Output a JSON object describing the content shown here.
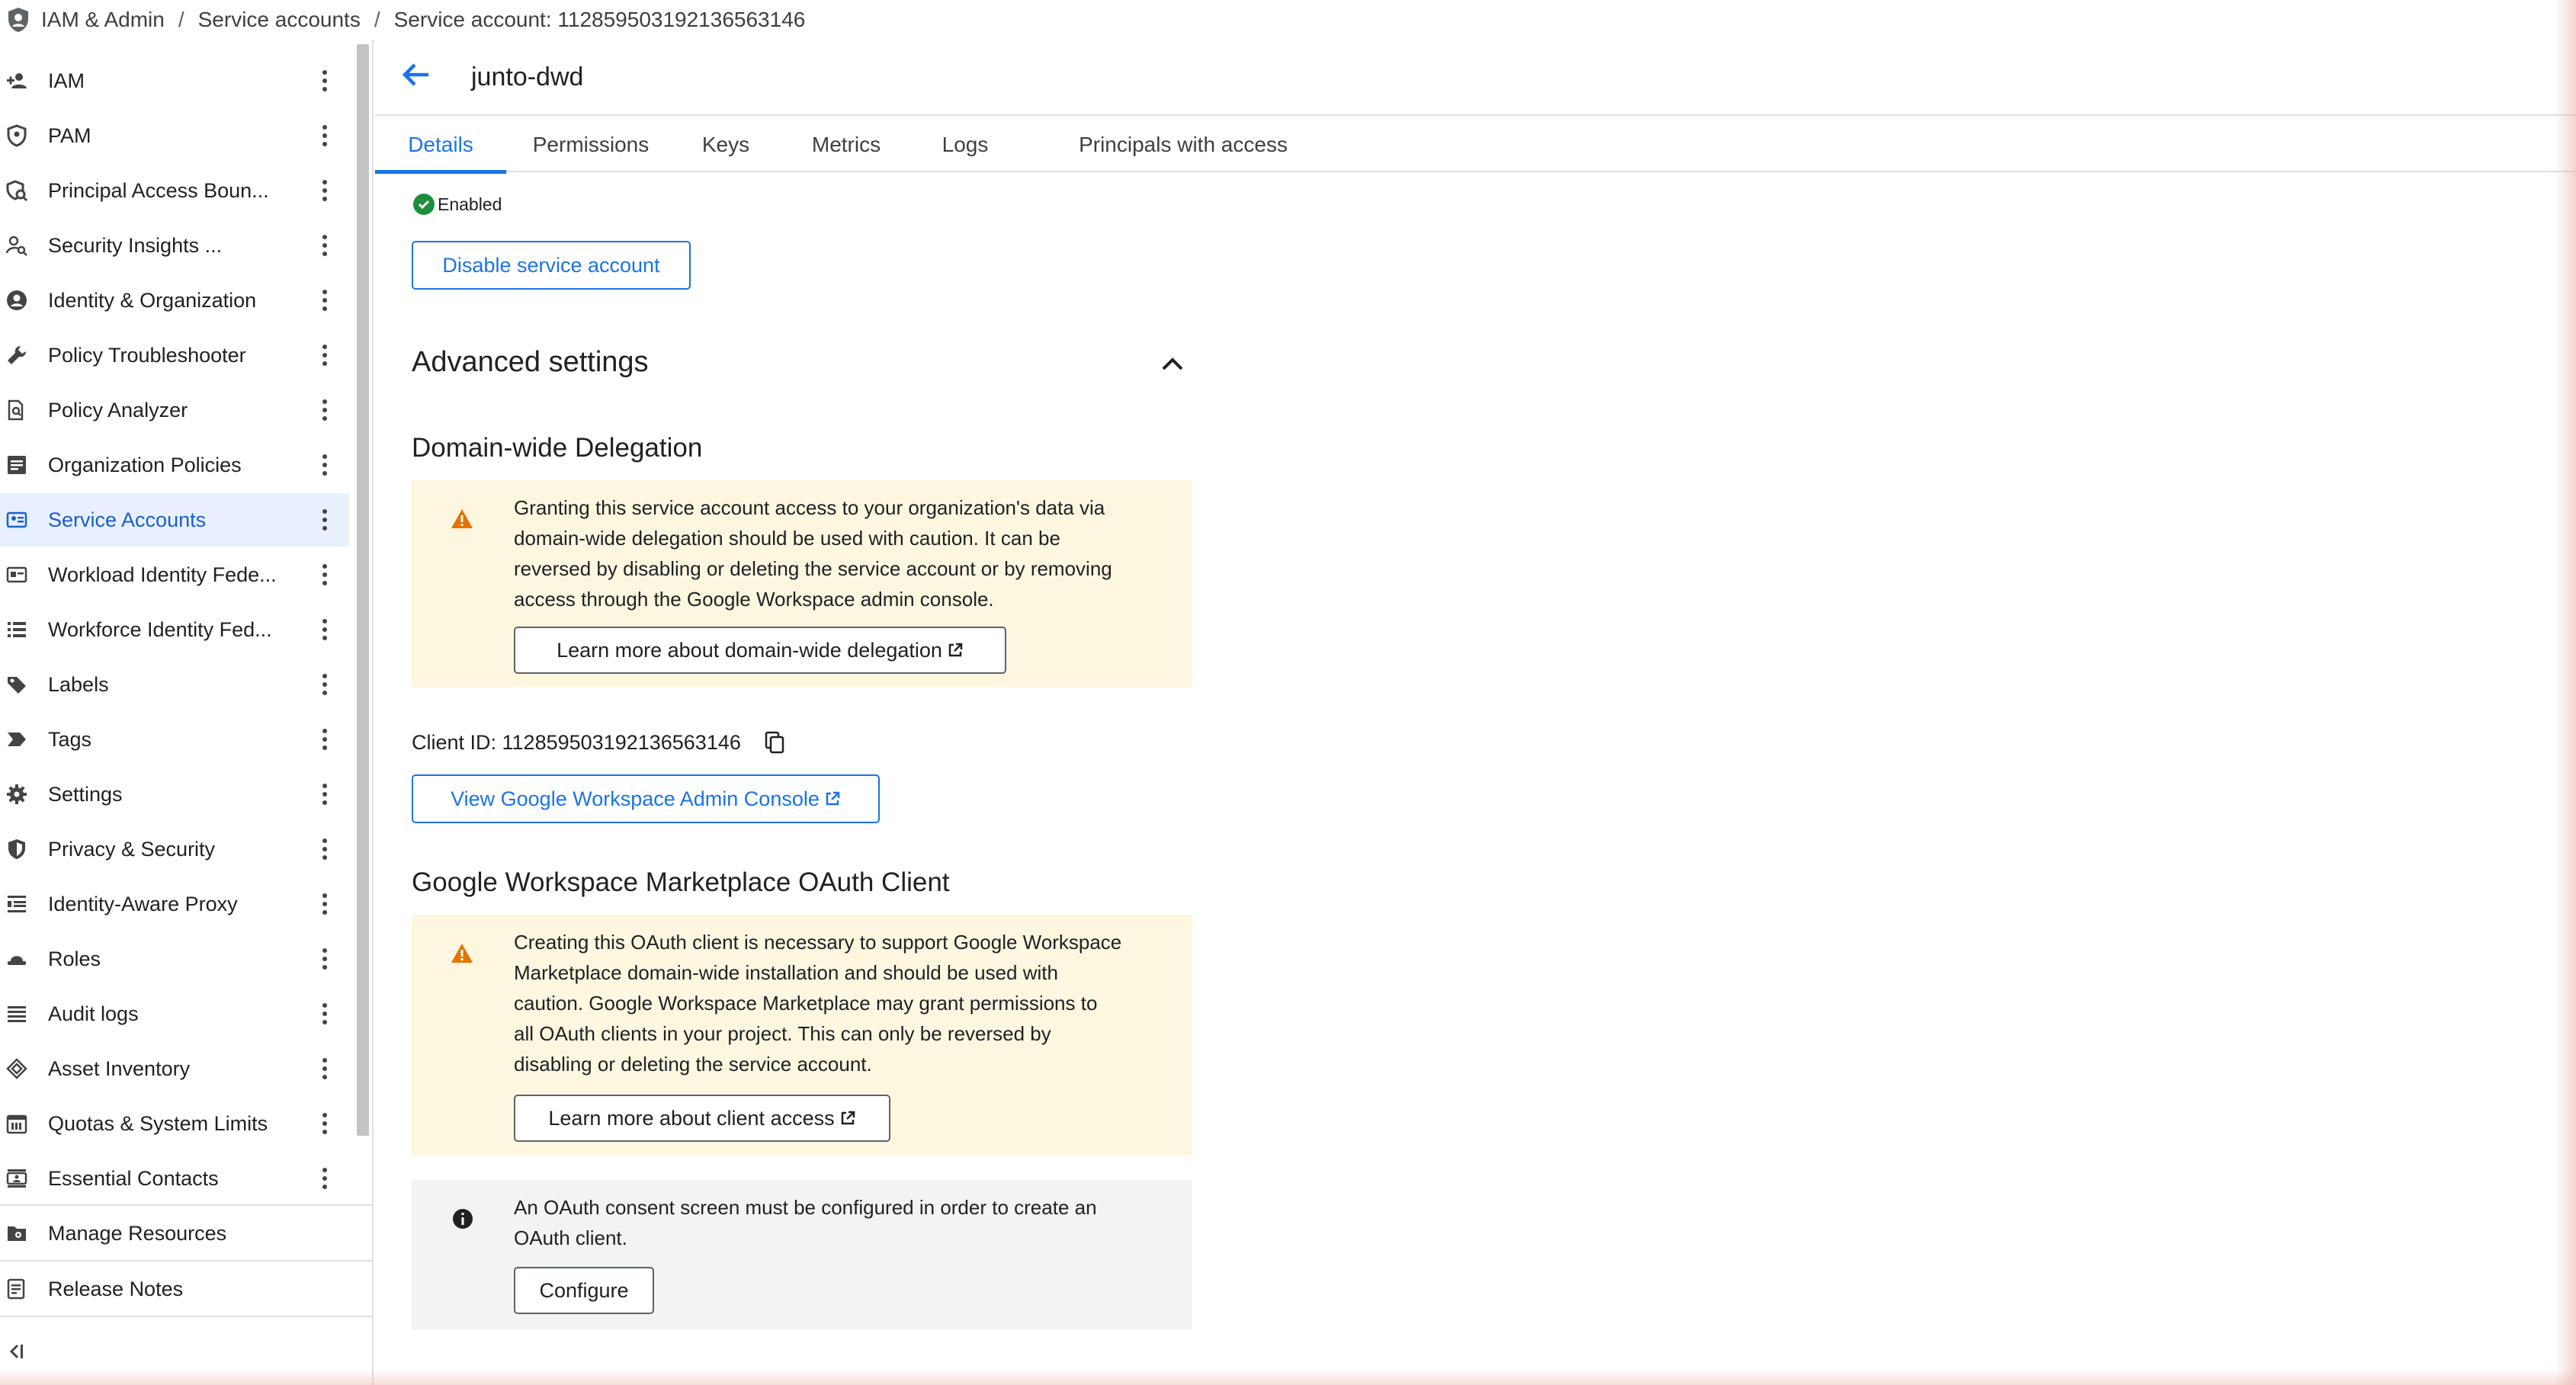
{
  "breadcrumb": {
    "items": [
      "IAM & Admin",
      "Service accounts",
      "Service account: 112859503192136563146"
    ],
    "separator": "/"
  },
  "sidebar": {
    "items": [
      {
        "label": "IAM",
        "icon": "add-person-icon"
      },
      {
        "label": "PAM",
        "icon": "shield-person-icon"
      },
      {
        "label": "Principal Access Boun...",
        "icon": "policy-icon"
      },
      {
        "label": "Security Insights ...",
        "icon": "person-search-icon"
      },
      {
        "label": "Identity & Organization",
        "icon": "account-circle-icon"
      },
      {
        "label": "Policy Troubleshooter",
        "icon": "wrench-icon"
      },
      {
        "label": "Policy Analyzer",
        "icon": "document-search-icon"
      },
      {
        "label": "Organization Policies",
        "icon": "list-box-icon"
      },
      {
        "label": "Service Accounts",
        "icon": "service-account-icon",
        "active": true
      },
      {
        "label": "Workload Identity Fede...",
        "icon": "id-card-icon"
      },
      {
        "label": "Workforce Identity Fed...",
        "icon": "list-icon"
      },
      {
        "label": "Labels",
        "icon": "label-icon"
      },
      {
        "label": "Tags",
        "icon": "tag-icon"
      },
      {
        "label": "Settings",
        "icon": "gear-icon"
      },
      {
        "label": "Privacy & Security",
        "icon": "shield-icon"
      },
      {
        "label": "Identity-Aware Proxy",
        "icon": "proxy-icon"
      },
      {
        "label": "Roles",
        "icon": "hat-icon"
      },
      {
        "label": "Audit logs",
        "icon": "lines-icon"
      },
      {
        "label": "Asset Inventory",
        "icon": "diamond-icon"
      },
      {
        "label": "Quotas & System Limits",
        "icon": "calendar-icon"
      },
      {
        "label": "Essential Contacts",
        "icon": "contacts-icon"
      }
    ],
    "footer": [
      {
        "label": "Manage Resources",
        "icon": "folder-gear-icon"
      },
      {
        "label": "Release Notes",
        "icon": "notes-icon"
      }
    ]
  },
  "header": {
    "title": "junto-dwd"
  },
  "tabs": [
    "Details",
    "Permissions",
    "Keys",
    "Metrics",
    "Logs",
    "Principals with access"
  ],
  "status": {
    "label": "Enabled"
  },
  "disable_button": "Disable service account",
  "advanced_settings": {
    "title": "Advanced settings"
  },
  "dwd": {
    "title": "Domain-wide Delegation",
    "warning_lines": [
      "Granting this service account access to your organization's data via",
      "domain-wide delegation should be used with caution. It can be",
      "reversed by disabling or deleting the service account or by removing",
      "access through the Google Workspace admin console."
    ],
    "learn_more": "Learn more about domain-wide delegation",
    "client_id": "Client ID: 112859503192136563146",
    "console_button": "View Google Workspace Admin Console"
  },
  "marketplace": {
    "title": "Google Workspace Marketplace OAuth Client",
    "warning_lines": [
      "Creating this OAuth client is necessary to support Google Workspace",
      "Marketplace domain-wide installation and should be used with",
      "caution. Google Workspace Marketplace may grant permissions to",
      "all OAuth clients in your project. This can only be reversed by",
      "disabling or deleting the service account."
    ],
    "learn_more": "Learn more about client access",
    "info_lines": [
      "An OAuth consent screen must be configured in order to create an",
      "OAuth client."
    ],
    "configure_button": "Configure"
  },
  "colors": {
    "accent": "#1a73e8",
    "active_nav_bg": "#e8f0fe",
    "warning_bg": "#fef7e0",
    "warning_icon": "#e37400",
    "info_bg": "#f1f3f4",
    "success": "#1e8e3e"
  }
}
